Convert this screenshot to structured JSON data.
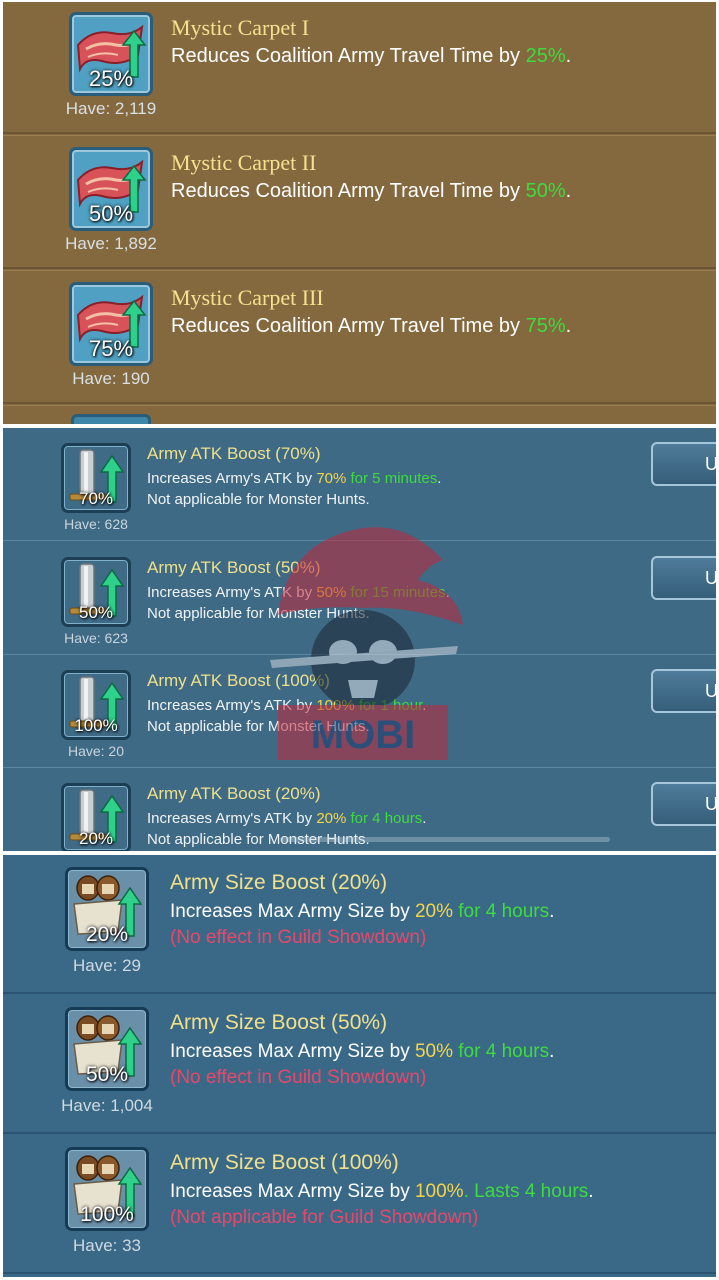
{
  "carpet_items": [
    {
      "title": "Mystic Carpet I",
      "desc_prefix": "Reduces Coalition Army Travel Time by ",
      "desc_value": "25%",
      "desc_suffix": ".",
      "icon_pct": "25%",
      "have": "Have: 2,119",
      "icon": "flying-carpet-icon"
    },
    {
      "title": "Mystic Carpet II",
      "desc_prefix": "Reduces Coalition Army Travel Time by ",
      "desc_value": "50%",
      "desc_suffix": ".",
      "icon_pct": "50%",
      "have": "Have: 1,892",
      "icon": "flying-carpet-icon"
    },
    {
      "title": "Mystic Carpet III",
      "desc_prefix": "Reduces Coalition Army Travel Time by ",
      "desc_value": "75%",
      "desc_suffix": ".",
      "icon_pct": "75%",
      "have": "Have: 190",
      "icon": "flying-carpet-icon"
    }
  ],
  "atk_items": [
    {
      "title": "Army ATK Boost (70%)",
      "l1_prefix": "Increases Army's ATK by ",
      "l1_value": "70%",
      "l1_duration": " for 5 minutes",
      "l1_suffix": ".",
      "l2": "Not applicable for Monster Hunts.",
      "icon_pct": "70%",
      "have": "Have: 628",
      "button": "U",
      "icon": "sword-up-icon"
    },
    {
      "title": "Army ATK Boost (50%)",
      "l1_prefix": "Increases Army's ATK by ",
      "l1_value": "50%",
      "l1_duration": " for 15 minutes",
      "l1_suffix": ".",
      "l2": "Not applicable for Monster Hunts.",
      "icon_pct": "50%",
      "have": "Have: 623",
      "button": "U",
      "icon": "sword-up-icon"
    },
    {
      "title": "Army ATK Boost (100%)",
      "l1_prefix": "Increases Army's ATK by ",
      "l1_value": "100%",
      "l1_duration": " for 1 hour",
      "l1_suffix": ".",
      "l2": "Not applicable for Monster Hunts.",
      "icon_pct": "100%",
      "have": "Have: 20",
      "button": "U",
      "icon": "sword-up-icon"
    },
    {
      "title": "Army ATK Boost (20%)",
      "l1_prefix": "Increases Army's ATK by ",
      "l1_value": "20%",
      "l1_duration": " for 4 hours",
      "l1_suffix": ".",
      "l2": "Not applicable for Monster Hunts.",
      "icon_pct": "20%",
      "have": "",
      "button": "U",
      "icon": "sword-up-icon"
    }
  ],
  "size_items": [
    {
      "title": "Army Size Boost (20%)",
      "l1_prefix": "Increases Max Army Size by ",
      "l1_value": "20%",
      "l1_duration": " for 4 hours",
      "l1_suffix": ".",
      "l2": "(No effect in Guild Showdown)",
      "icon_pct": "20%",
      "have": "Have: 29",
      "icon": "soldiers-up-icon"
    },
    {
      "title": "Army Size Boost (50%)",
      "l1_prefix": "Increases Max Army Size by ",
      "l1_value": "50%",
      "l1_duration": " for 4 hours",
      "l1_suffix": ".",
      "l2": "(No effect in Guild Showdown)",
      "icon_pct": "50%",
      "have": "Have: 1,004",
      "icon": "soldiers-up-icon"
    },
    {
      "title": "Army Size Boost (100%)",
      "l1_prefix": "Increases Max Army Size by ",
      "l1_value": "100%",
      "l1_duration": ". Lasts 4 hours",
      "l1_suffix": ".",
      "l2": "(Not applicable for Guild Showdown)",
      "icon_pct": "100%",
      "have": "Have: 33",
      "icon": "soldiers-up-icon"
    }
  ],
  "watermark": {
    "text": "MOBI",
    "icon": "pirate-skull-logo"
  },
  "colors": {
    "carpet_bg": "#84693f",
    "atk_bg": "#3e6a85",
    "size_bg": "#3a6987",
    "title": "#f4e18f",
    "green": "#3ddc3d",
    "gold": "#f5d547",
    "red": "#e8476a"
  }
}
